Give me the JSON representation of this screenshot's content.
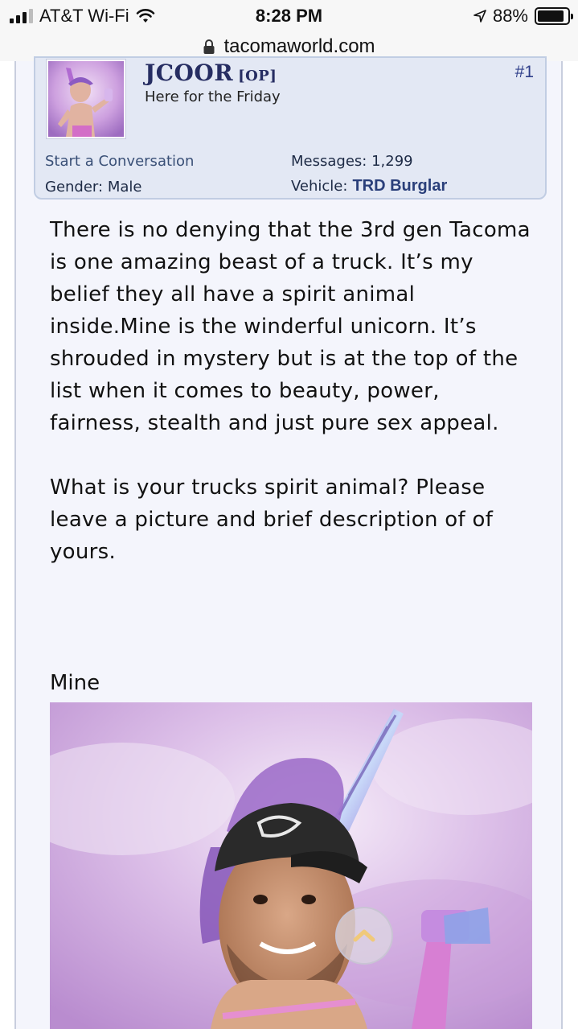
{
  "status_bar": {
    "carrier": "AT&T Wi-Fi",
    "time": "8:28 PM",
    "battery_percent": "88%",
    "battery_level": 0.88
  },
  "browser": {
    "url": "tacomaworld.com"
  },
  "user": {
    "name": "JCOOR",
    "op_tag": "[OP]",
    "title": "Here for the Friday",
    "post_number": "#1",
    "start_conversation": "Start a Conversation",
    "gender_label": "Gender:",
    "gender_value": "Male",
    "messages_label": "Messages:",
    "messages_value": "1,299",
    "vehicle_label": "Vehicle:",
    "vehicle_value": "TRD Burglar"
  },
  "post": {
    "paragraph1": "There is no denying that the 3rd gen Tacoma is one amazing beast of a truck. It’s my belief they all have a spirit animal inside.Mine is the winderful unicorn. It’s shrouded in mystery but is at the top of the list when it comes to beauty, power, fairness, stealth and just pure sex appeal.",
    "paragraph2": "What is your trucks spirit animal? Please leave a picture and brief description of of yours.",
    "mine_label": "Mine"
  },
  "icons": {
    "signal": "signal-bars-icon",
    "wifi": "wifi-icon",
    "location": "location-arrow-icon",
    "battery": "battery-icon",
    "lock": "lock-icon",
    "scroll_top": "chevron-up-icon"
  },
  "colors": {
    "username": "#262d62",
    "userblock_bg": "#e3e8f4",
    "page_bg": "#f4f5fc",
    "link": "#3a5077"
  }
}
